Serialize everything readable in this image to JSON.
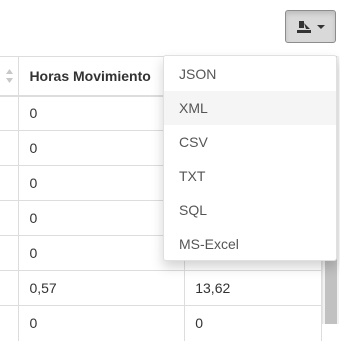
{
  "toolbar": {
    "export_icon": "export-icon",
    "export_caret": "caret-down"
  },
  "table": {
    "headers": [
      "",
      "Horas Movimiento",
      ""
    ],
    "rows": [
      [
        "",
        "0",
        ""
      ],
      [
        "",
        "0",
        ""
      ],
      [
        "",
        "0",
        ""
      ],
      [
        "",
        "0",
        ""
      ],
      [
        "",
        "0",
        ""
      ],
      [
        "",
        "0,57",
        "13,62"
      ],
      [
        "",
        "0",
        "0"
      ]
    ]
  },
  "export_menu": {
    "items": [
      "JSON",
      "XML",
      "CSV",
      "TXT",
      "SQL",
      "MS-Excel"
    ]
  }
}
